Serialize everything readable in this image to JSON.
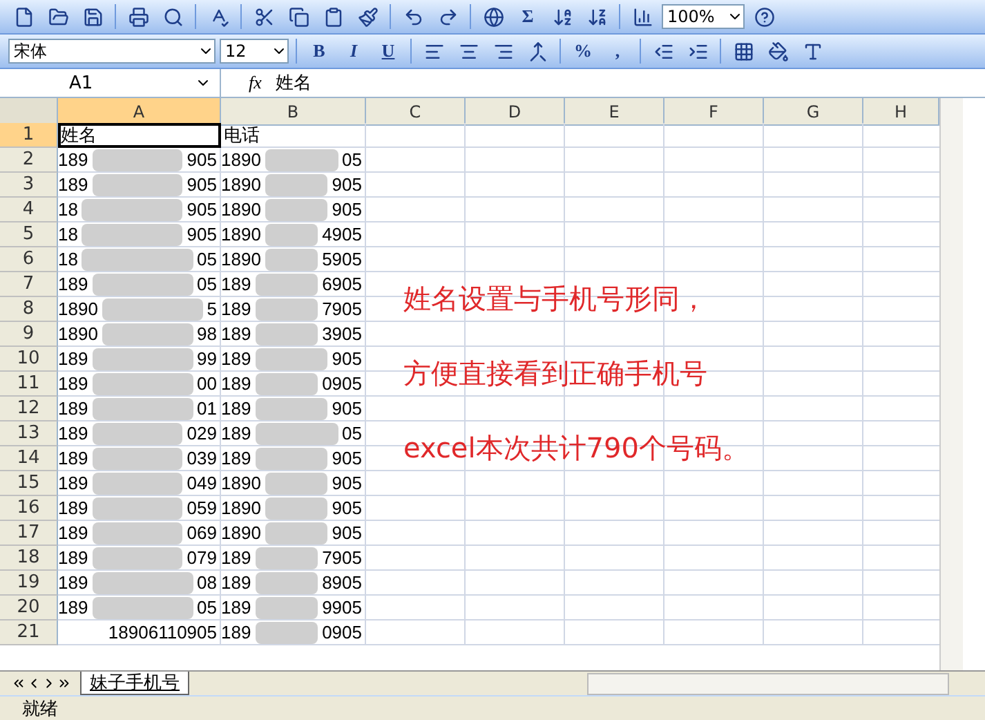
{
  "toolbar": {
    "sum_symbol": "Σ",
    "zoom": "100%"
  },
  "format_bar": {
    "font": "宋体",
    "size": "12",
    "bold": "B",
    "italic": "I",
    "underline": "U",
    "percent": "%",
    "comma": ","
  },
  "formula_bar": {
    "name_box": "A1",
    "fx": "fx",
    "content": "姓名"
  },
  "columns": [
    {
      "label": "A",
      "selected": true
    },
    {
      "label": "B",
      "selected": false
    },
    {
      "label": "C",
      "selected": false
    },
    {
      "label": "D",
      "selected": false
    },
    {
      "label": "E",
      "selected": false
    },
    {
      "label": "F",
      "selected": false
    },
    {
      "label": "G",
      "selected": false
    },
    {
      "label": "H",
      "selected": false
    }
  ],
  "rows": [
    {
      "n": "1",
      "cells": [
        {
          "text": "姓名",
          "selected": true
        },
        {
          "text": "电话",
          "selected": false
        }
      ]
    },
    {
      "n": "2",
      "cells": [
        {
          "start": "189",
          "end": "905"
        },
        {
          "start": "1890",
          "end": "05"
        }
      ]
    },
    {
      "n": "3",
      "cells": [
        {
          "start": "189",
          "end": "905"
        },
        {
          "start": "1890",
          "end": "905"
        }
      ]
    },
    {
      "n": "4",
      "cells": [
        {
          "start": "18",
          "end": "905"
        },
        {
          "start": "1890",
          "end": "905"
        }
      ]
    },
    {
      "n": "5",
      "cells": [
        {
          "start": "18",
          "end": "905"
        },
        {
          "start": "1890",
          "end": "4905"
        }
      ]
    },
    {
      "n": "6",
      "cells": [
        {
          "start": "18",
          "end": "05"
        },
        {
          "start": "1890",
          "end": "5905"
        }
      ]
    },
    {
      "n": "7",
      "cells": [
        {
          "start": "189",
          "end": "05"
        },
        {
          "start": "189",
          "end": "6905"
        }
      ]
    },
    {
      "n": "8",
      "cells": [
        {
          "start": "1890",
          "end": "5"
        },
        {
          "start": "189",
          "end": "7905"
        }
      ]
    },
    {
      "n": "9",
      "cells": [
        {
          "start": "1890",
          "end": "98"
        },
        {
          "start": "189",
          "end": "3905"
        }
      ]
    },
    {
      "n": "10",
      "cells": [
        {
          "start": "189",
          "end": "99"
        },
        {
          "start": "189",
          "end": "905"
        }
      ]
    },
    {
      "n": "11",
      "cells": [
        {
          "start": "189",
          "end": "00"
        },
        {
          "start": "189",
          "end": "0905"
        }
      ]
    },
    {
      "n": "12",
      "cells": [
        {
          "start": "189",
          "end": "01"
        },
        {
          "start": "189",
          "end": "905"
        }
      ]
    },
    {
      "n": "13",
      "cells": [
        {
          "start": "189",
          "end": "029"
        },
        {
          "start": "189",
          "end": "05"
        }
      ]
    },
    {
      "n": "14",
      "cells": [
        {
          "start": "189",
          "end": "039"
        },
        {
          "start": "189",
          "end": "905"
        }
      ]
    },
    {
      "n": "15",
      "cells": [
        {
          "start": "189",
          "end": "049"
        },
        {
          "start": "1890",
          "end": "905"
        }
      ]
    },
    {
      "n": "16",
      "cells": [
        {
          "start": "189",
          "end": "059"
        },
        {
          "start": "1890",
          "end": "905"
        }
      ]
    },
    {
      "n": "17",
      "cells": [
        {
          "start": "189",
          "end": "069"
        },
        {
          "start": "1890",
          "end": "905"
        }
      ]
    },
    {
      "n": "18",
      "cells": [
        {
          "start": "189",
          "end": "079"
        },
        {
          "start": "189",
          "end": "7905"
        }
      ]
    },
    {
      "n": "19",
      "cells": [
        {
          "start": "189",
          "end": "08"
        },
        {
          "start": "189",
          "end": "8905"
        }
      ]
    },
    {
      "n": "20",
      "cells": [
        {
          "start": "189",
          "end": "05"
        },
        {
          "start": "189",
          "end": "9905"
        }
      ]
    },
    {
      "n": "21",
      "cells": [
        {
          "text": "18906110905"
        },
        {
          "start": "189",
          "end": "0905"
        }
      ]
    }
  ],
  "annotation": [
    "姓名设置与手机号形同，",
    "方便直接看到正确手机号",
    "excel本次共计790个号码。"
  ],
  "sheet_tabs": [
    {
      "label": "妹子手机号",
      "selected": true
    }
  ],
  "status_bar": {
    "text": "就绪"
  }
}
